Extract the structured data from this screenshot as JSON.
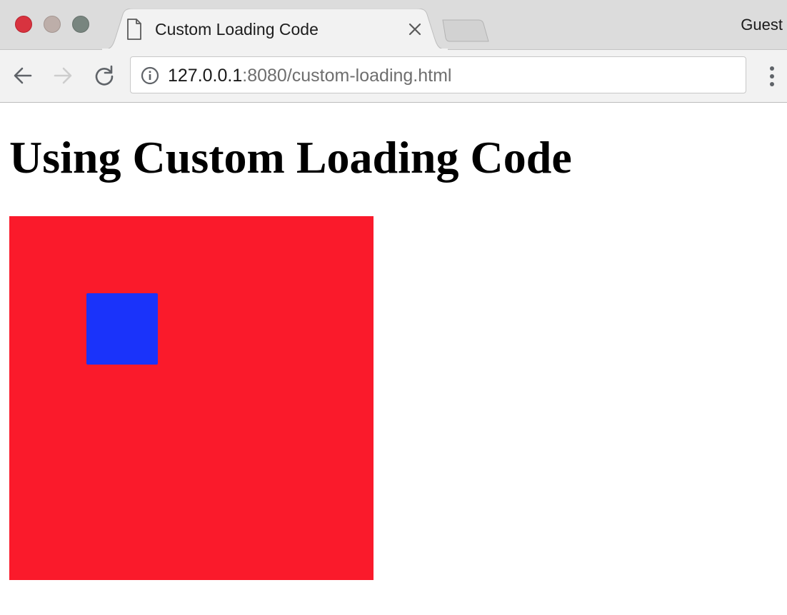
{
  "window": {
    "profile_label": "Guest",
    "tab": {
      "title": "Custom Loading Code"
    }
  },
  "toolbar": {
    "url_host": "127.0.0.1",
    "url_rest": ":8080/custom-loading.html"
  },
  "page": {
    "heading": "Using Custom Loading Code"
  },
  "colors": {
    "red_square": "#fa1a2b",
    "blue_square": "#1a33fa",
    "tab_active": "#f2f2f2",
    "tabstrip": "#dcdcdc"
  },
  "icons": {
    "tab": "document-icon",
    "close": "close-icon",
    "back": "back-arrow-icon",
    "forward": "forward-arrow-icon",
    "reload": "reload-icon",
    "info": "info-icon",
    "menu": "kebab-menu-icon"
  }
}
